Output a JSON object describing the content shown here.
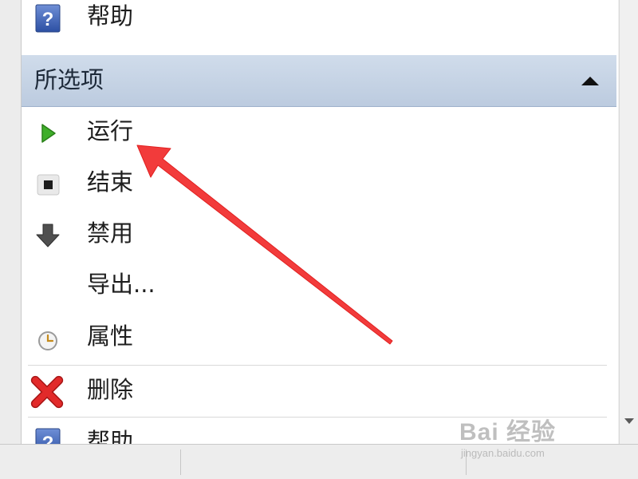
{
  "menu": {
    "top_help_label": "帮助",
    "section_title": "所选项",
    "items": [
      {
        "label": "运行",
        "icon": "play-icon"
      },
      {
        "label": "结束",
        "icon": "stop-icon"
      },
      {
        "label": "禁用",
        "icon": "disable-down-arrow-icon"
      },
      {
        "label": "导出...",
        "icon": ""
      },
      {
        "label": "属性",
        "icon": "clock-properties-icon"
      },
      {
        "label": "删除",
        "icon": "delete-x-icon"
      },
      {
        "label": "帮助",
        "icon": "help-icon"
      }
    ]
  },
  "watermark": {
    "brand": "Bai 经验",
    "url": "jingyan.baidu.com"
  },
  "colors": {
    "section_header": "#c8d6e8",
    "annotation_arrow": "#f23b3b",
    "play_green": "#3fae2a",
    "delete_red": "#e22a2a",
    "help_blue": "#3a63b8"
  }
}
